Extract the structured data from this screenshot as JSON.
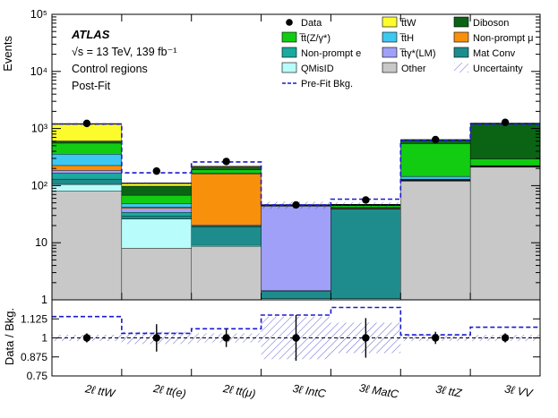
{
  "chart_data": {
    "type": "bar",
    "stacked": true,
    "y_scale": "log",
    "ylabel": "Events",
    "ylim": [
      1,
      100000
    ],
    "yticks": [
      "1",
      "10",
      "10²",
      "10³",
      "10⁴",
      "10⁵"
    ],
    "categories": [
      "2ℓ ttW",
      "2ℓ tt(e)",
      "2ℓ tt(μ)",
      "3ℓ IntC",
      "3ℓ MatC",
      "3ℓ ttZ",
      "3ℓ VV"
    ],
    "annotation": {
      "experiment": "ATLAS",
      "lines": [
        "√s = 13 TeV, 139 fb⁻¹",
        "Control regions",
        "Post-Fit"
      ]
    },
    "series": [
      {
        "name": "Other",
        "color": "#c8c8c8",
        "values": [
          80,
          8,
          8.5,
          1.0,
          1.0,
          120,
          210
        ]
      },
      {
        "name": "QMisID",
        "color": "#b8fcfc",
        "values": [
          25,
          18,
          0.5,
          0.05,
          0.05,
          1,
          1
        ]
      },
      {
        "name": "Mat Conv",
        "color": "#1e8c8c",
        "values": [
          25,
          3,
          10,
          0.35,
          38,
          2,
          2
        ]
      },
      {
        "name": "Non-prompt e",
        "color": "#1aaaa0",
        "values": [
          35,
          5,
          0.8,
          0.05,
          0.05,
          2,
          2
        ]
      },
      {
        "name": "t̅tγ*(LM)",
        "color": "#a0a0f8",
        "values": [
          20,
          6,
          0.7,
          42,
          0.5,
          2,
          2
        ]
      },
      {
        "name": "Non-prompt μ",
        "color": "#f8900c",
        "values": [
          40,
          2,
          140,
          0.3,
          1,
          3,
          3
        ]
      },
      {
        "name": "t̅tH",
        "color": "#3cc8f0",
        "values": [
          130,
          6,
          5,
          0.3,
          1,
          15,
          4
        ]
      },
      {
        "name": "t̅t(Z/γ*)",
        "color": "#12cc12",
        "values": [
          200,
          20,
          25,
          1,
          3,
          400,
          70
        ]
      },
      {
        "name": "Diboson",
        "color": "#0a6414",
        "values": [
          50,
          30,
          15,
          0.5,
          1,
          80,
          930
        ]
      },
      {
        "name": "t̅tW",
        "color": "#fcfc2c",
        "values": [
          600,
          12,
          10,
          0.3,
          1,
          10,
          5
        ]
      }
    ],
    "data_points": [
      {
        "value": 1230
      },
      {
        "value": 180
      },
      {
        "value": 265
      },
      {
        "value": 46
      },
      {
        "value": 56
      },
      {
        "value": 640
      },
      {
        "value": 1280
      }
    ],
    "prefit_bkg": [
      1200,
      168,
      260,
      46,
      58,
      620,
      1200
    ],
    "ratio": {
      "ylabel": "Data / Bkg.",
      "ylim": [
        0.75,
        1.25
      ],
      "yticks": [
        "0.75",
        "0.875",
        "1",
        "1.125"
      ],
      "values": [
        1.0,
        1.0,
        1.0,
        1.0,
        1.0,
        1.0,
        1.0
      ],
      "errors": [
        0.03,
        0.09,
        0.06,
        0.15,
        0.13,
        0.04,
        0.03
      ],
      "uncertainty": [
        0.02,
        0.04,
        0.03,
        0.14,
        0.1,
        0.02,
        0.02
      ],
      "prefit": [
        1.14,
        1.03,
        1.06,
        1.15,
        1.2,
        1.02,
        1.07
      ]
    },
    "legend": [
      {
        "label": "Data",
        "kind": "marker"
      },
      {
        "label": "t̅tW",
        "color": "#fcfc2c"
      },
      {
        "label": "Diboson",
        "color": "#0a6414"
      },
      {
        "label": "t̅t(Z/γ*)",
        "color": "#12cc12"
      },
      {
        "label": "t̅tH",
        "color": "#3cc8f0"
      },
      {
        "label": "Non-prompt μ",
        "color": "#f8900c"
      },
      {
        "label": "Non-prompt e",
        "color": "#1aaaa0"
      },
      {
        "label": "t̅tγ*(LM)",
        "color": "#a0a0f8"
      },
      {
        "label": "Mat Conv",
        "color": "#1e8c8c"
      },
      {
        "label": "QMisID",
        "color": "#b8fcfc"
      },
      {
        "label": "Other",
        "color": "#c8c8c8"
      },
      {
        "label": "Uncertainty",
        "kind": "hatch"
      },
      {
        "label": "Pre-Fit Bkg.",
        "kind": "dashed"
      }
    ],
    "legend_placement": "top-right",
    "grid": false
  }
}
